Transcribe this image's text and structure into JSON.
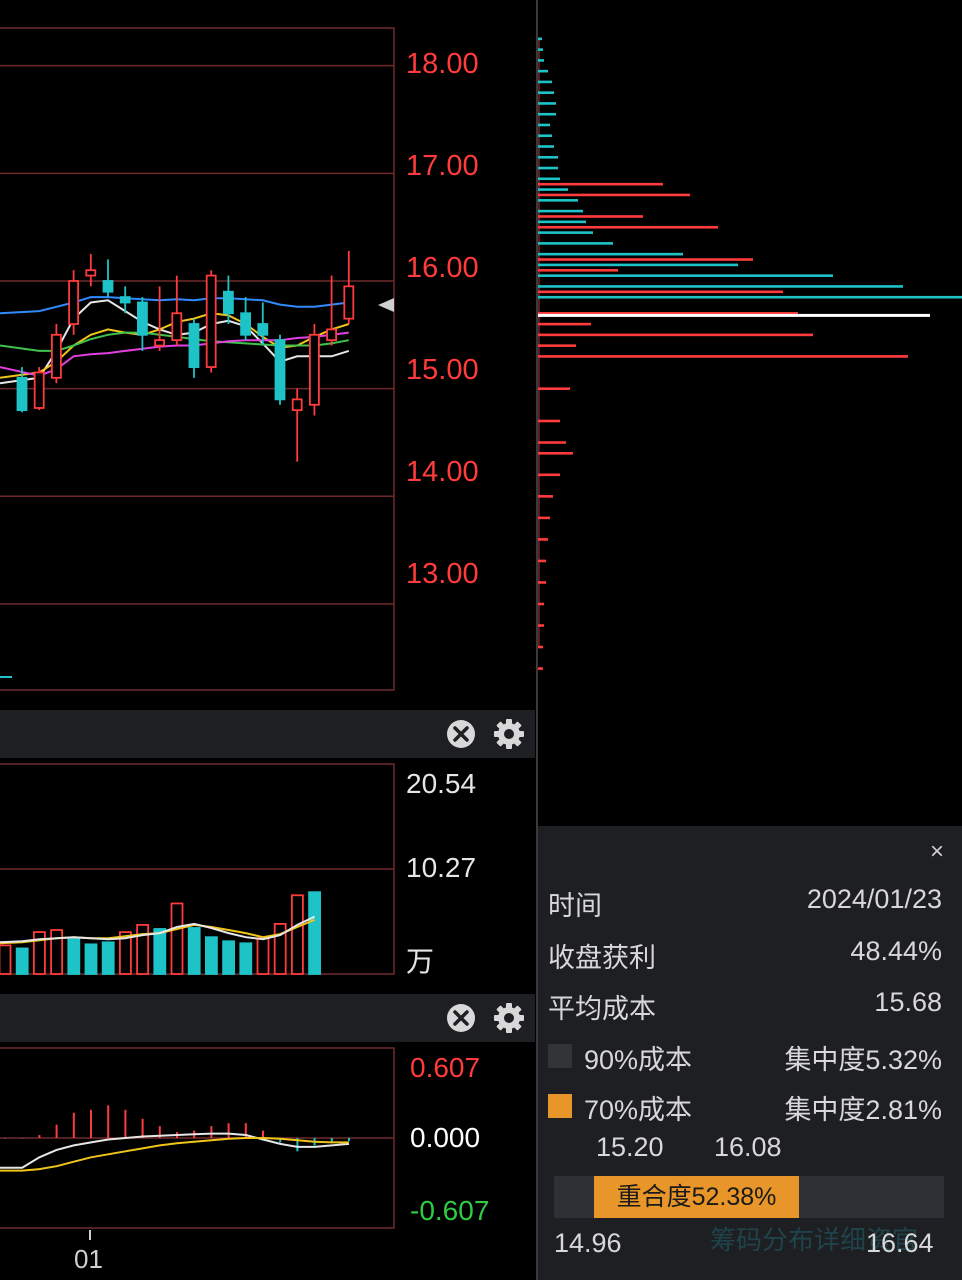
{
  "price_axis": [
    "18.00",
    "17.00",
    "16.00",
    "15.00",
    "14.00",
    "13.00"
  ],
  "volume_axis": {
    "top": "20.54",
    "mid": "10.27",
    "unit": "万"
  },
  "macd_axis": {
    "top": "0.607",
    "mid": "0.000",
    "bottom": "-0.607"
  },
  "date_label": "01",
  "colors": {
    "up": "#ff3b3b",
    "down": "#1ec3c8",
    "bg": "#000000",
    "panel": "#1e1f22",
    "accent": "#e8962a"
  },
  "icons": {
    "close": "close-circle-icon",
    "settings": "gear-icon"
  },
  "info": {
    "time_label": "时间",
    "time_value": "2024/01/23",
    "profit_label": "收盘获利",
    "profit_value": "48.44%",
    "avg_cost_label": "平均成本",
    "avg_cost_value": "15.68",
    "cost90_label": "90%成本",
    "cost90_conc": "集中度5.32%",
    "cost70_label": "70%成本",
    "cost70_conc": "集中度2.81%",
    "range70_low": "15.20",
    "range70_high": "16.08",
    "overlap_label": "重合度52.38%",
    "range90_low": "14.96",
    "range90_high": "16.64",
    "watermark": "筹码分布详细资官",
    "close_symbol": "×"
  },
  "chart_data": [
    {
      "type": "candlestick",
      "title": "",
      "y_ticks": [
        18,
        17,
        16,
        15,
        14,
        13
      ],
      "ylim": [
        12.2,
        18.35
      ],
      "candles": [
        {
          "o": 15.1,
          "c": 14.8,
          "h": 15.2,
          "l": 14.78
        },
        {
          "o": 14.82,
          "c": 15.15,
          "h": 15.2,
          "l": 14.8
        },
        {
          "o": 15.1,
          "c": 15.5,
          "h": 15.6,
          "l": 15.05
        },
        {
          "o": 15.6,
          "c": 16.0,
          "h": 16.1,
          "l": 15.5
        },
        {
          "o": 16.05,
          "c": 16.1,
          "h": 16.25,
          "l": 15.95
        },
        {
          "o": 16.0,
          "c": 15.9,
          "h": 16.2,
          "l": 15.85
        },
        {
          "o": 15.85,
          "c": 15.8,
          "h": 15.95,
          "l": 15.7
        },
        {
          "o": 15.8,
          "c": 15.5,
          "h": 15.85,
          "l": 15.35
        },
        {
          "o": 15.4,
          "c": 15.45,
          "h": 15.95,
          "l": 15.35
        },
        {
          "o": 15.45,
          "c": 15.7,
          "h": 16.05,
          "l": 15.4
        },
        {
          "o": 15.6,
          "c": 15.2,
          "h": 15.65,
          "l": 15.1
        },
        {
          "o": 15.2,
          "c": 16.05,
          "h": 16.1,
          "l": 15.15
        },
        {
          "o": 15.9,
          "c": 15.7,
          "h": 16.05,
          "l": 15.6
        },
        {
          "o": 15.7,
          "c": 15.5,
          "h": 15.85,
          "l": 15.45
        },
        {
          "o": 15.6,
          "c": 15.5,
          "h": 15.8,
          "l": 15.4
        },
        {
          "o": 15.45,
          "c": 14.9,
          "h": 15.5,
          "l": 14.85
        },
        {
          "o": 14.8,
          "c": 14.9,
          "h": 15.0,
          "l": 14.32
        },
        {
          "o": 14.85,
          "c": 15.5,
          "h": 15.6,
          "l": 14.75
        },
        {
          "o": 15.45,
          "c": 15.55,
          "h": 16.05,
          "l": 15.4
        },
        {
          "o": 15.65,
          "c": 15.95,
          "h": 16.28,
          "l": 15.6
        }
      ],
      "ma_lines": [
        {
          "color": "#2f8bff",
          "values": [
            15.7,
            15.72,
            15.76,
            15.8,
            15.85,
            15.85,
            15.84,
            15.83,
            15.82,
            15.83,
            15.82,
            15.84,
            15.84,
            15.83,
            15.82,
            15.78,
            15.76,
            15.76,
            15.78,
            15.8
          ]
        },
        {
          "color": "#e6e6e6",
          "values": [
            15.05,
            15.1,
            15.35,
            15.65,
            15.8,
            15.82,
            15.72,
            15.62,
            15.55,
            15.5,
            15.52,
            15.6,
            15.63,
            15.58,
            15.42,
            15.25,
            15.3,
            15.3,
            15.3,
            15.35
          ]
        },
        {
          "color": "#f0c419",
          "values": [
            15.1,
            15.15,
            15.25,
            15.4,
            15.5,
            15.55,
            15.52,
            15.5,
            15.55,
            15.62,
            15.65,
            15.7,
            15.68,
            15.6,
            15.48,
            15.38,
            15.4,
            15.48,
            15.55,
            15.6
          ]
        },
        {
          "color": "#3ec24c",
          "values": [
            15.4,
            15.35,
            15.35,
            15.4,
            15.46,
            15.5,
            15.52,
            15.52,
            15.5,
            15.48,
            15.46,
            15.44,
            15.43,
            15.42,
            15.41,
            15.4,
            15.4,
            15.4,
            15.42,
            15.45
          ]
        },
        {
          "color": "#e040e0",
          "values": [
            15.2,
            15.12,
            15.18,
            15.3,
            15.32,
            15.33,
            15.35,
            15.37,
            15.39,
            15.4,
            15.4,
            15.42,
            15.44,
            15.45,
            15.45,
            15.45,
            15.47,
            15.48,
            15.5,
            15.52
          ]
        }
      ]
    },
    {
      "type": "bar",
      "title": "",
      "unit": "万",
      "ylim": [
        0,
        20.54
      ],
      "values": [
        2.8,
        2.5,
        4.1,
        4.3,
        3.4,
        2.9,
        3.1,
        4.1,
        4.8,
        4.4,
        6.9,
        4.5,
        3.6,
        3.2,
        3.0,
        3.5,
        4.9,
        7.7,
        8.0
      ],
      "up": [
        true,
        false,
        true,
        true,
        false,
        false,
        false,
        true,
        true,
        false,
        true,
        false,
        false,
        false,
        false,
        true,
        true,
        true,
        false
      ],
      "ma_lines": [
        {
          "color": "#f0c419",
          "values": [
            3.0,
            3.1,
            3.3,
            3.5,
            3.6,
            3.5,
            3.5,
            3.7,
            3.9,
            4.0,
            4.4,
            4.8,
            4.6,
            4.3,
            4.0,
            3.6,
            3.9,
            4.6,
            5.3
          ]
        },
        {
          "color": "#e6e6e6",
          "values": [
            3.1,
            3.2,
            3.4,
            3.5,
            3.6,
            3.5,
            3.4,
            3.5,
            3.8,
            4.0,
            4.6,
            4.9,
            4.5,
            4.0,
            3.6,
            3.4,
            3.8,
            4.8,
            5.6
          ]
        }
      ]
    },
    {
      "type": "bar",
      "title": "",
      "ylim": [
        -0.607,
        0.607
      ],
      "values": [
        -0.003,
        -0.003,
        0.02,
        0.09,
        0.17,
        0.19,
        0.22,
        0.19,
        0.13,
        0.08,
        0.04,
        0.05,
        0.08,
        0.1,
        0.1,
        0.05,
        -0.03,
        -0.09,
        -0.05,
        -0.03,
        -0.02
      ],
      "lines": [
        {
          "color": "#e6e6e6",
          "values": [
            -0.2,
            -0.2,
            -0.13,
            -0.08,
            -0.05,
            -0.03,
            -0.01,
            0.0,
            0.01,
            0.015,
            0.02,
            0.025,
            0.03,
            0.03,
            0.02,
            -0.01,
            -0.04,
            -0.06,
            -0.06,
            -0.05,
            -0.04
          ]
        },
        {
          "color": "#f0c419",
          "values": [
            -0.22,
            -0.22,
            -0.21,
            -0.19,
            -0.16,
            -0.13,
            -0.11,
            -0.09,
            -0.07,
            -0.05,
            -0.035,
            -0.025,
            -0.015,
            -0.005,
            0.0,
            0.0,
            -0.005,
            -0.015,
            -0.025,
            -0.03,
            -0.03
          ]
        }
      ]
    },
    {
      "type": "bar",
      "title": "",
      "orientation": "horizontal",
      "ylim": [
        12.2,
        18.35
      ],
      "avg_cost": 15.68,
      "profit_rows": [
        15.3,
        15.5,
        15.7,
        15.9,
        16.2,
        16.5,
        16.8,
        16.9,
        16.6,
        16.1,
        15.6,
        15.4,
        15.0,
        14.7,
        14.5,
        14.4,
        14.2,
        14.0,
        13.8,
        13.6,
        13.4,
        13.2,
        13.0,
        12.8,
        12.6,
        12.4
      ],
      "profit_values": [
        370,
        275,
        260,
        245,
        215,
        180,
        152,
        125,
        105,
        80,
        53,
        38,
        32,
        22,
        28,
        35,
        22,
        15,
        12,
        10,
        8,
        8,
        6,
        6,
        5,
        5
      ],
      "loss_rows": [
        15.85,
        15.95,
        16.05,
        16.15,
        16.25,
        16.35,
        16.45,
        16.55,
        16.65,
        16.75,
        16.85,
        16.95,
        17.05,
        17.15,
        17.25,
        17.35,
        17.45,
        17.55,
        17.65,
        17.75,
        17.85,
        17.95,
        18.05,
        18.15,
        18.25
      ],
      "loss_values": [
        425,
        365,
        295,
        200,
        145,
        75,
        55,
        48,
        45,
        40,
        30,
        22,
        20,
        20,
        16,
        14,
        12,
        18,
        18,
        16,
        14,
        10,
        6,
        5,
        4
      ]
    }
  ]
}
